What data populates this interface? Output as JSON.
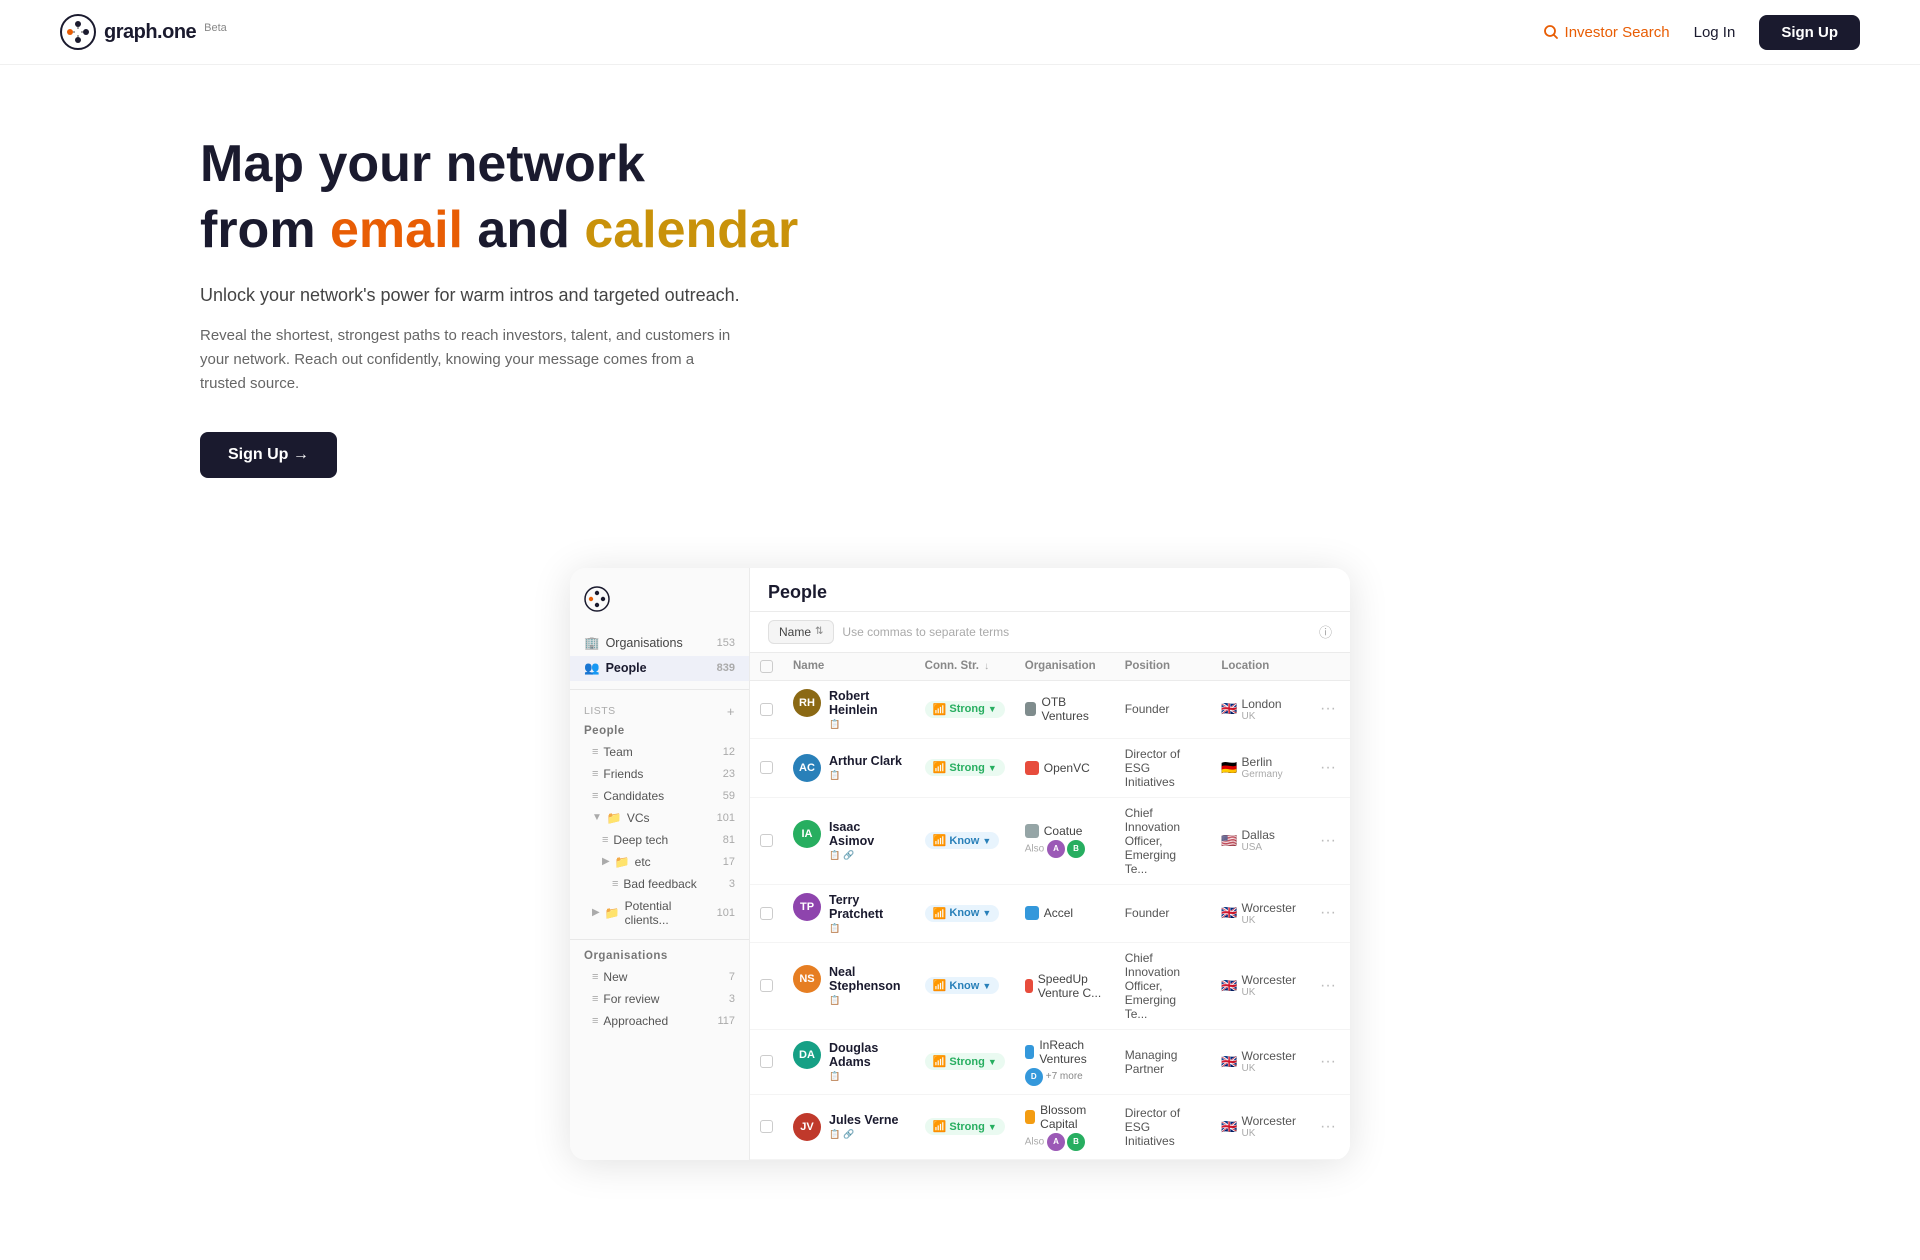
{
  "navbar": {
    "logo_text": "graph.one",
    "beta_label": "Beta",
    "investor_search_label": "Investor Search",
    "login_label": "Log In",
    "signup_label": "Sign Up"
  },
  "hero": {
    "title_line1": "Map your network",
    "title_line2_prefix": "from ",
    "title_line2_email": "email",
    "title_line2_mid": " and ",
    "title_line2_calendar": "calendar",
    "subtitle": "Unlock your network's power for warm intros and targeted outreach.",
    "body": "Reveal the shortest, strongest paths to reach investors, talent, and customers in your network. Reach out confidently, knowing your message comes from a trusted source.",
    "cta_label": "Sign Up →"
  },
  "app": {
    "sidebar": {
      "logo_alt": "graph.one logo",
      "nav_items": [
        {
          "label": "Organisations",
          "count": "153",
          "icon": "🏢"
        },
        {
          "label": "People",
          "count": "839",
          "icon": "👥",
          "active": true
        }
      ],
      "lists_label": "LISTS",
      "lists_section_label": "People",
      "lists_items": [
        {
          "label": "Team",
          "count": "12",
          "indent": 1
        },
        {
          "label": "Friends",
          "count": "23",
          "indent": 1
        },
        {
          "label": "Candidates",
          "count": "59",
          "indent": 1
        },
        {
          "label": "VCs",
          "count": "101",
          "indent": 1,
          "folder": true
        },
        {
          "label": "Deep tech",
          "count": "81",
          "indent": 2
        },
        {
          "label": "etc",
          "count": "17",
          "indent": 2,
          "folder": true
        },
        {
          "label": "Bad feedback",
          "count": "3",
          "indent": 3
        },
        {
          "label": "Potential clients...",
          "count": "101",
          "indent": 1,
          "folder": true
        }
      ],
      "orgs_section_label": "Organisations",
      "orgs_items": [
        {
          "label": "New",
          "count": "7",
          "indent": 1
        },
        {
          "label": "For review",
          "count": "3",
          "indent": 1
        },
        {
          "label": "Approached",
          "count": "117",
          "indent": 1
        }
      ]
    },
    "main": {
      "title": "People",
      "filter_name_label": "Name",
      "filter_placeholder": "Use commas to separate terms",
      "table": {
        "columns": [
          "",
          "Name",
          "Conn. Str.",
          "Organisation",
          "Position",
          "Location",
          ""
        ],
        "rows": [
          {
            "name": "Robert Heinlein",
            "avatar_color": "#8B6914",
            "avatar_initials": "RH",
            "conn_str": "Strong",
            "conn_type": "strong",
            "org": "OTB Ventures",
            "org_color": "#7f8c8d",
            "position": "Founder",
            "location": "London",
            "country": "UK",
            "flag": "🇬🇧"
          },
          {
            "name": "Arthur Clark",
            "avatar_color": "#2980b9",
            "avatar_initials": "AC",
            "conn_str": "Strong",
            "conn_type": "strong",
            "org": "OpenVC",
            "org_color": "#e74c3c",
            "position": "Director of ESG Initiatives",
            "location": "Berlin",
            "country": "Germany",
            "flag": "🇩🇪"
          },
          {
            "name": "Isaac Asimov",
            "avatar_color": "#27ae60",
            "avatar_initials": "IA",
            "conn_str": "Know",
            "conn_type": "know",
            "org": "Coatue",
            "org_color": "#95a5a6",
            "position": "Chief Innovation Officer, Emerging Te...",
            "location": "Dallas",
            "country": "USA",
            "flag": "🇺🇸",
            "also": true
          },
          {
            "name": "Terry Pratchett",
            "avatar_color": "#8e44ad",
            "avatar_initials": "TP",
            "conn_str": "Know",
            "conn_type": "know",
            "org": "Accel",
            "org_color": "#3498db",
            "position": "Founder",
            "location": "Worcester",
            "country": "UK",
            "flag": "🇬🇧"
          },
          {
            "name": "Neal Stephenson",
            "avatar_color": "#e67e22",
            "avatar_initials": "NS",
            "conn_str": "Know",
            "conn_type": "know",
            "org": "SpeedUp Venture C...",
            "org_color": "#e74c3c",
            "position": "Chief Innovation Officer, Emerging Te...",
            "location": "Worcester",
            "country": "UK",
            "flag": "🇬🇧"
          },
          {
            "name": "Douglas Adams",
            "avatar_color": "#16a085",
            "avatar_initials": "DA",
            "conn_str": "Strong",
            "conn_type": "strong",
            "org": "InReach Ventures",
            "org_color": "#3498db",
            "position": "Managing Partner",
            "location": "Worcester",
            "country": "UK",
            "flag": "🇬🇧",
            "extra": "+7 more"
          },
          {
            "name": "Jules Verne",
            "avatar_color": "#c0392b",
            "avatar_initials": "JV",
            "conn_str": "Strong",
            "conn_type": "strong",
            "org": "Blossom Capital",
            "org_color": "#f39c12",
            "position": "Director of ESG Initiatives",
            "location": "Worcester",
            "country": "UK",
            "flag": "🇬🇧",
            "also": true
          }
        ]
      }
    }
  }
}
